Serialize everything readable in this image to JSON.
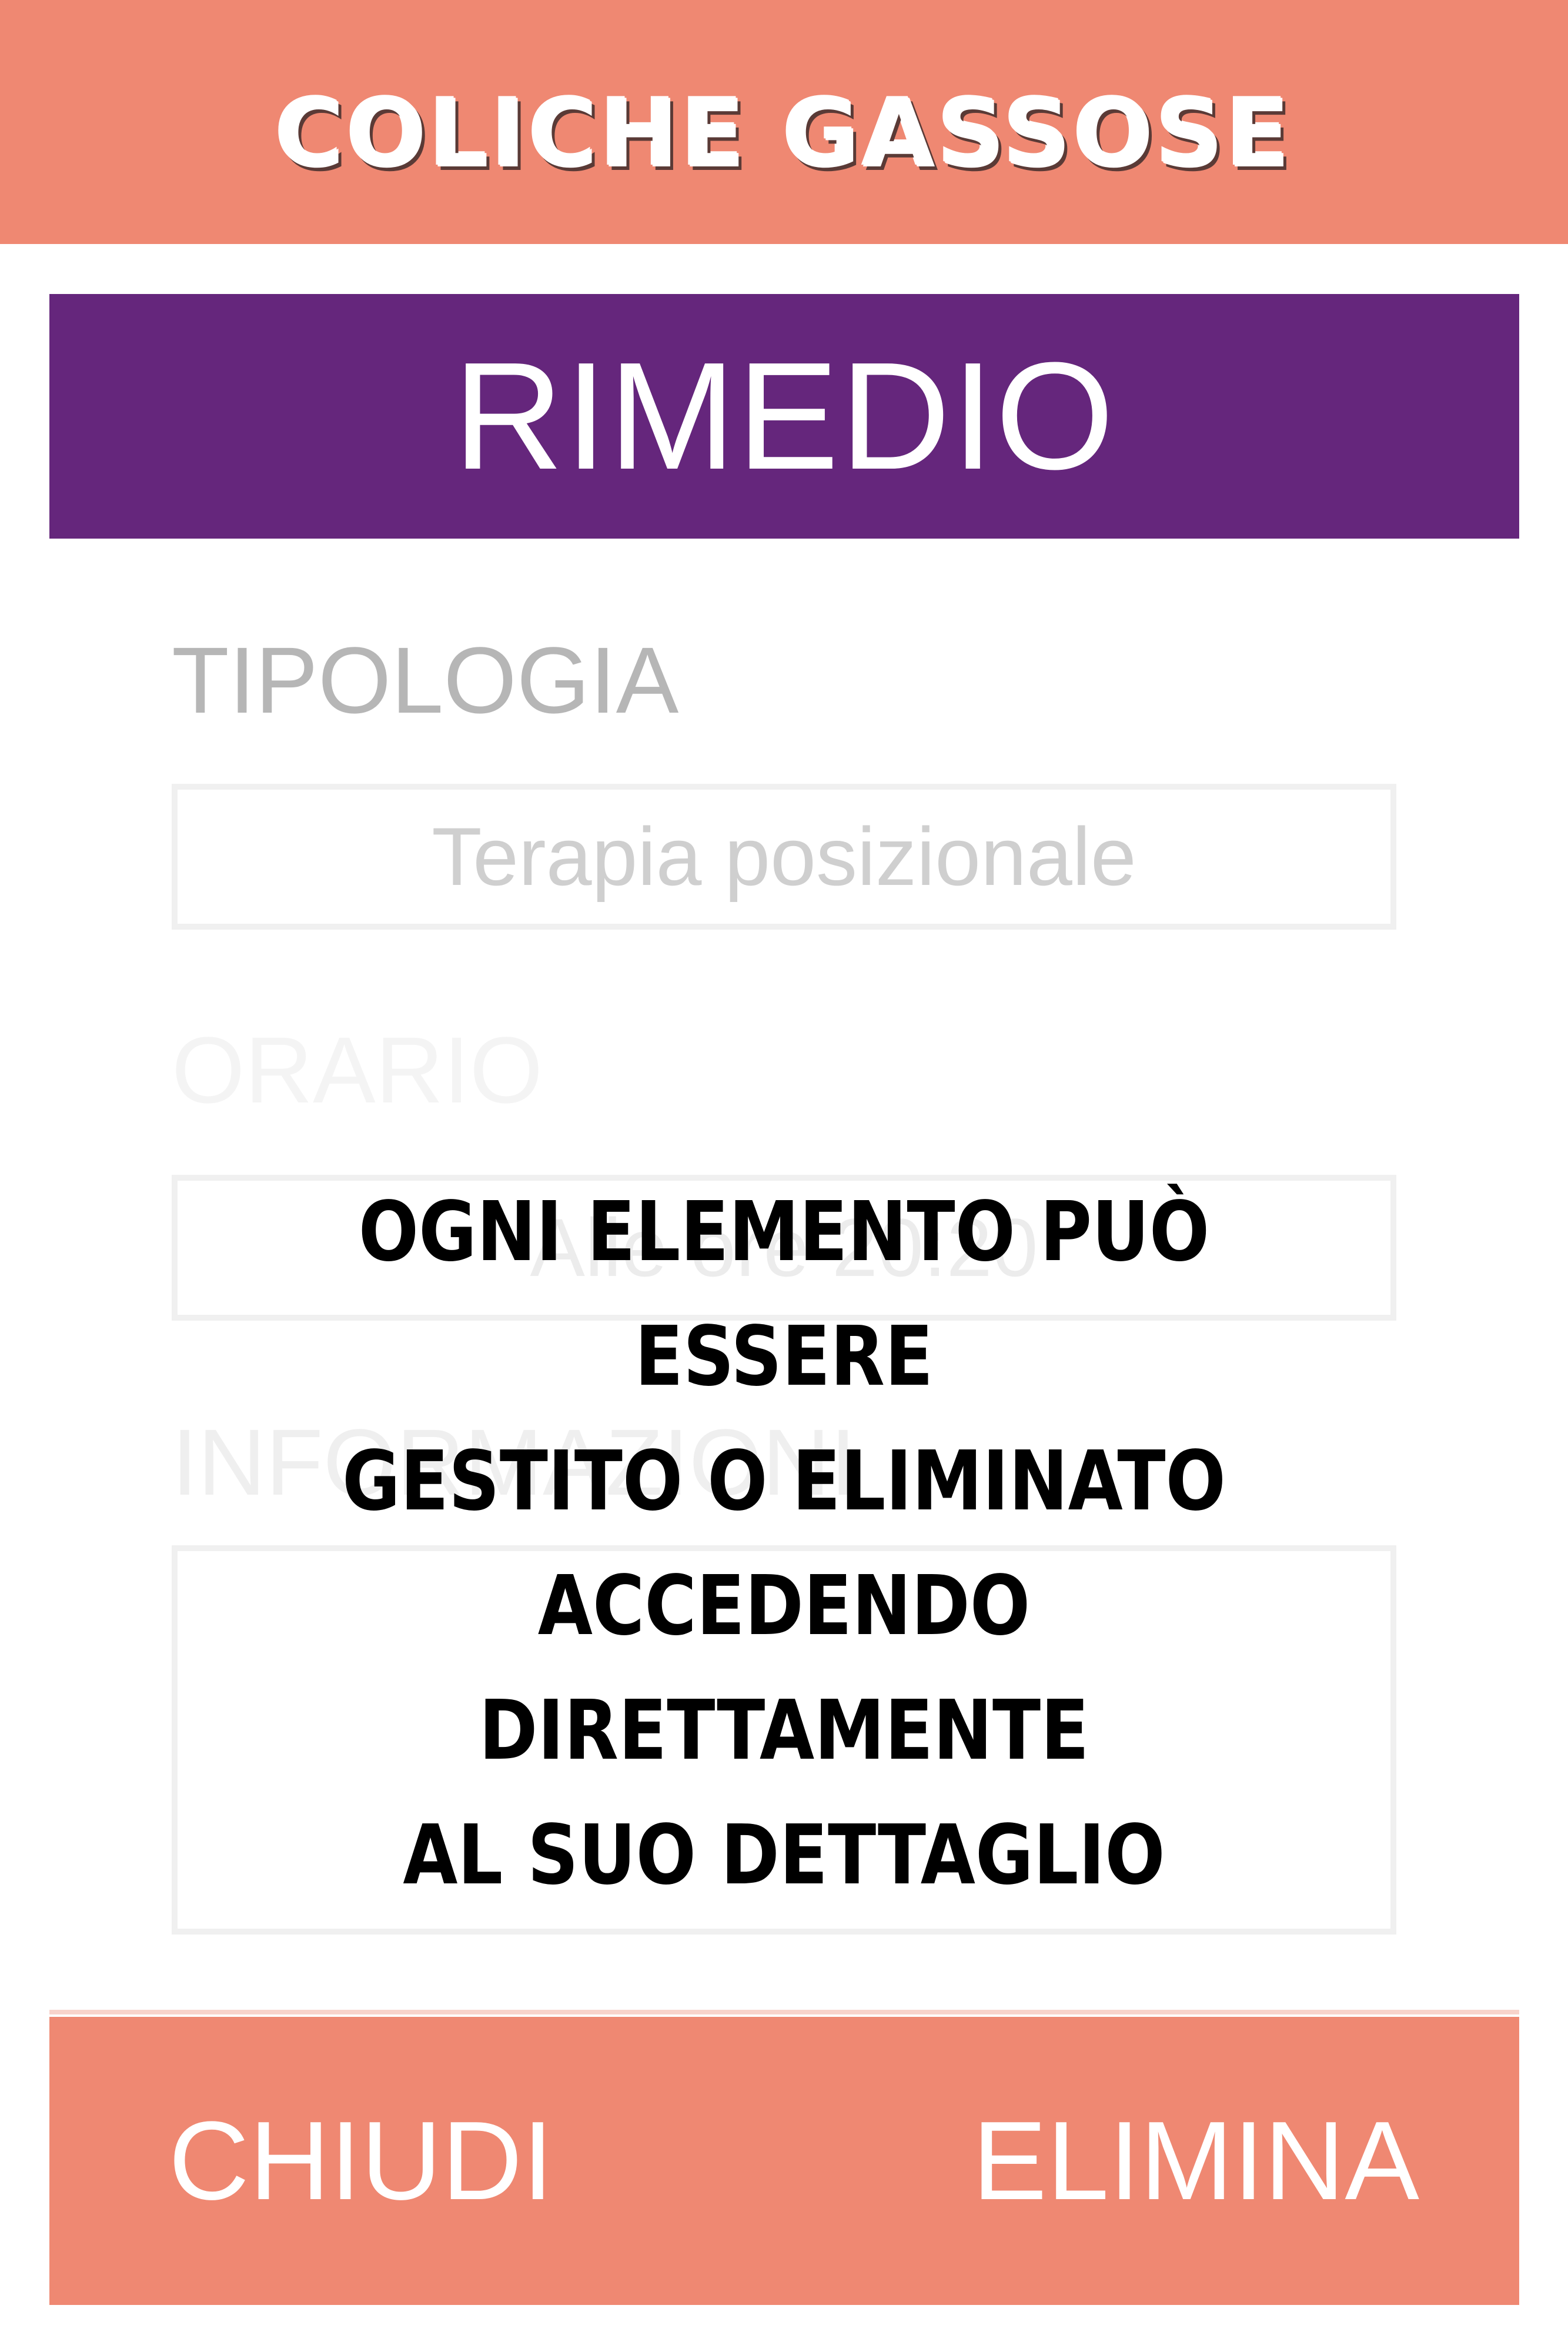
{
  "header": {
    "title": "COLICHE GASSOSE"
  },
  "banner": {
    "title": "RIMEDIO"
  },
  "form": {
    "tipologia": {
      "label": "TIPOLOGIA",
      "value": "Terapia posizionale"
    },
    "orario": {
      "label": "ORARIO",
      "value": "Alle ore 20:20"
    },
    "note": {
      "label": "INFORMAZIONI"
    }
  },
  "overlay": {
    "lines": [
      "OGNI ELEMENTO PUÒ ESSERE",
      "GESTITO O ELIMINATO",
      "ACCEDENDO DIRETTAMENTE",
      "AL SUO DETTAGLIO"
    ]
  },
  "footer": {
    "close_label": "CHIUDI",
    "delete_label": "ELIMINA"
  },
  "colors": {
    "accent": "#ef8872",
    "banner": "#65267c",
    "text_on_accent": "#ffffff"
  }
}
